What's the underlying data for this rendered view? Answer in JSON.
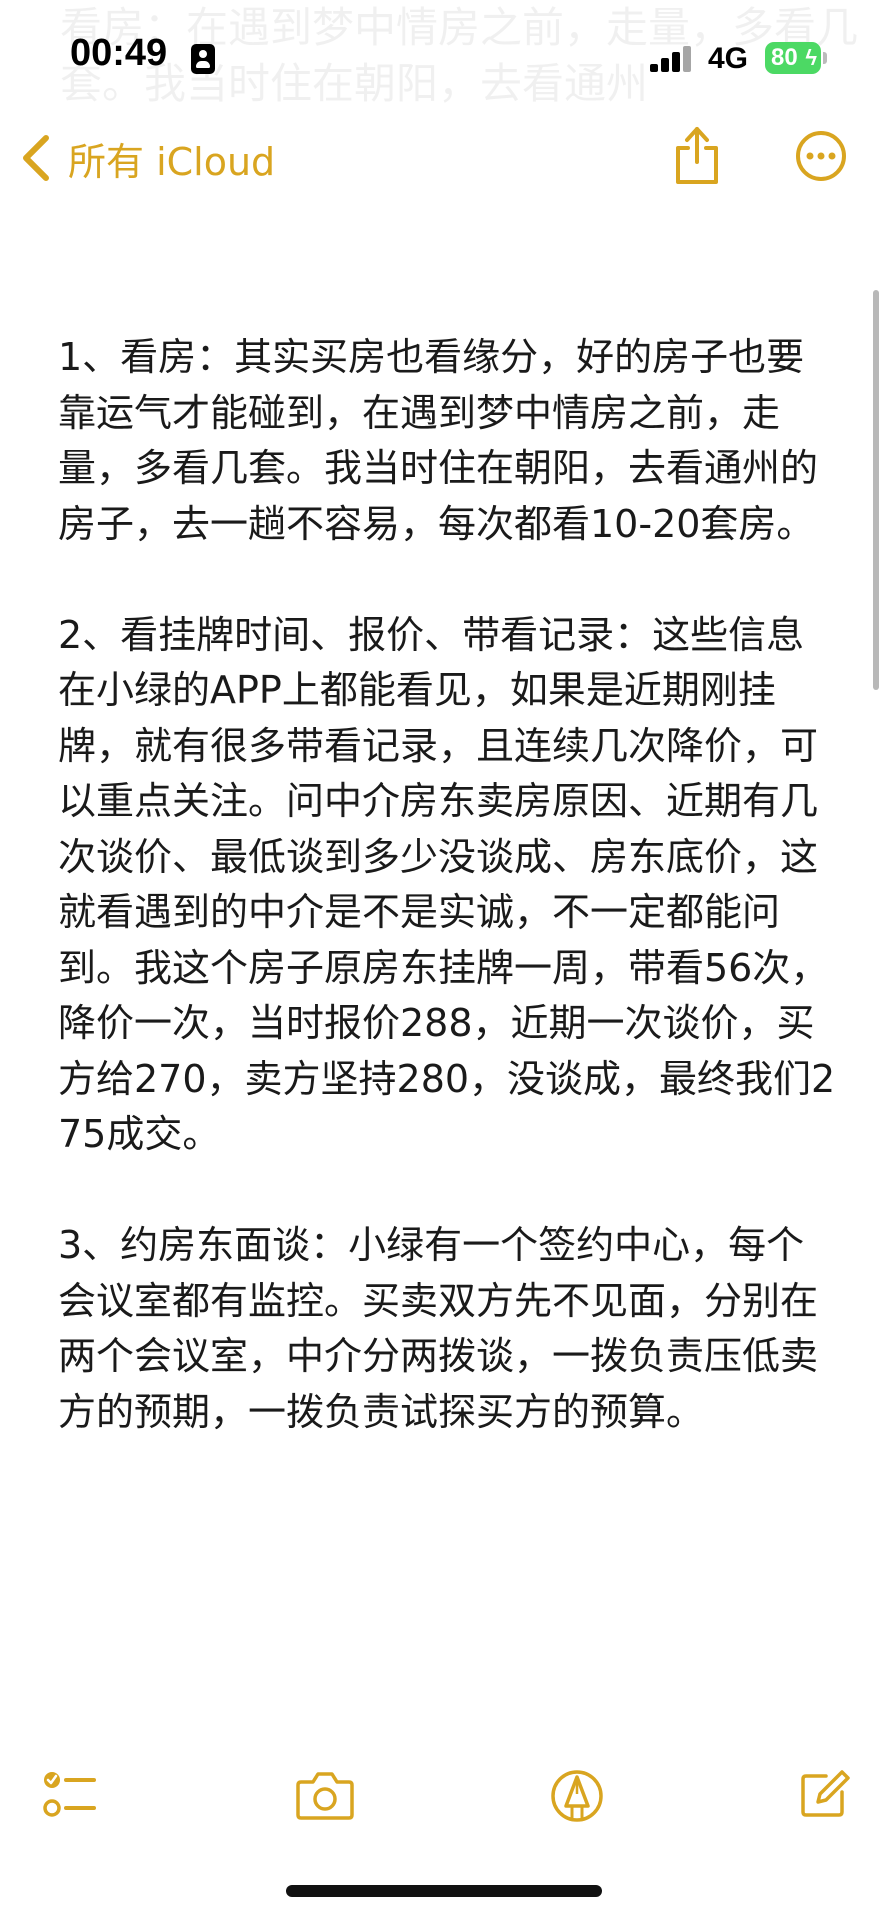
{
  "status_bar": {
    "time": "00:49",
    "network": "4G",
    "battery": "80"
  },
  "nav": {
    "back_label": "所有 iCloud"
  },
  "ghost_text": "看房：在遇到梦中情房之前，走量，多看几套。我当时住在朝阳，去看通州",
  "note": {
    "paragraphs": [
      "1、看房：其实买房也看缘分，好的房子也要靠运气才能碰到，在遇到梦中情房之前，走量，多看几套。我当时住在朝阳，去看通州的房子，去一趟不容易，每次都看10-20套房。",
      "2、看挂牌时间、报价、带看记录：这些信息在小绿的APP上都能看见，如果是近期刚挂牌，就有很多带看记录，且连续几次降价，可以重点关注。问中介房东卖房原因、近期有几次谈价、最低谈到多少没谈成、房东底价，这就看遇到的中介是不是实诚，不一定都能问到。我这个房子原房东挂牌一周，带看56次，降价一次，当时报价288，近期一次谈价，买方给270，卖方坚持280，没谈成，最终我们275成交。",
      "3、约房东面谈：小绿有一个签约中心，每个会议室都有监控。买卖双方先不见面，分别在两个会议室，中介分两拨谈，一拨负责压低卖方的预期，一拨负责试探买方的预算。"
    ]
  },
  "colors": {
    "accent": "#d9a520",
    "text": "#1a1a1a",
    "battery_green": "#4cd964"
  },
  "icons": {
    "back": "chevron-left-icon",
    "share": "share-icon",
    "more": "ellipsis-circle-icon",
    "checklist": "checklist-icon",
    "camera": "camera-icon",
    "markup": "pen-tip-icon",
    "compose": "compose-icon"
  }
}
